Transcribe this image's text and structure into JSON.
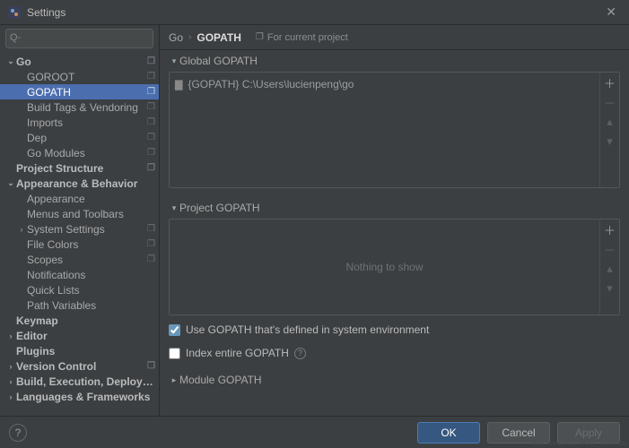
{
  "window": {
    "title": "Settings"
  },
  "search": {
    "placeholder": ""
  },
  "tree": [
    {
      "label": "Go",
      "kind": "section",
      "indent": 0,
      "arrow": "down",
      "layers": true
    },
    {
      "label": "GOROOT",
      "kind": "child",
      "indent": 1,
      "layers": true
    },
    {
      "label": "GOPATH",
      "kind": "child",
      "indent": 1,
      "layers": true,
      "selected": true
    },
    {
      "label": "Build Tags & Vendoring",
      "kind": "child",
      "indent": 1,
      "layers": true
    },
    {
      "label": "Imports",
      "kind": "child",
      "indent": 1,
      "layers": true
    },
    {
      "label": "Dep",
      "kind": "child",
      "indent": 1,
      "layers": true
    },
    {
      "label": "Go Modules",
      "kind": "child",
      "indent": 1,
      "layers": true
    },
    {
      "label": "Project Structure",
      "kind": "section",
      "indent": 0,
      "layers": true
    },
    {
      "label": "Appearance & Behavior",
      "kind": "section",
      "indent": 0,
      "arrow": "down"
    },
    {
      "label": "Appearance",
      "kind": "child",
      "indent": 1
    },
    {
      "label": "Menus and Toolbars",
      "kind": "child",
      "indent": 1
    },
    {
      "label": "System Settings",
      "kind": "child",
      "indent": 1,
      "arrow": "right",
      "layers": true
    },
    {
      "label": "File Colors",
      "kind": "child",
      "indent": 1,
      "layers": true
    },
    {
      "label": "Scopes",
      "kind": "child",
      "indent": 1,
      "layers": true
    },
    {
      "label": "Notifications",
      "kind": "child",
      "indent": 1
    },
    {
      "label": "Quick Lists",
      "kind": "child",
      "indent": 1
    },
    {
      "label": "Path Variables",
      "kind": "child",
      "indent": 1
    },
    {
      "label": "Keymap",
      "kind": "section",
      "indent": 0
    },
    {
      "label": "Editor",
      "kind": "section",
      "indent": 0,
      "arrow": "right"
    },
    {
      "label": "Plugins",
      "kind": "section",
      "indent": 0
    },
    {
      "label": "Version Control",
      "kind": "section",
      "indent": 0,
      "arrow": "right",
      "layers": true
    },
    {
      "label": "Build, Execution, Deployment",
      "kind": "section",
      "indent": 0,
      "arrow": "right"
    },
    {
      "label": "Languages & Frameworks",
      "kind": "section",
      "indent": 0,
      "arrow": "right"
    }
  ],
  "breadcrumb": {
    "root": "Go",
    "current": "GOPATH",
    "scope": "For current project"
  },
  "sections": {
    "global": {
      "title": "Global GOPATH",
      "rows": [
        {
          "path": "{GOPATH} C:\\Users\\lucienpeng\\go"
        }
      ]
    },
    "project": {
      "title": "Project GOPATH",
      "empty": "Nothing to show"
    },
    "module": {
      "title": "Module GOPATH"
    }
  },
  "options": {
    "useSystem": {
      "label": "Use GOPATH that's defined in system environment",
      "checked": true
    },
    "indexEntire": {
      "label": "Index entire GOPATH",
      "checked": false
    }
  },
  "footer": {
    "ok": "OK",
    "cancel": "Cancel",
    "apply": "Apply"
  }
}
